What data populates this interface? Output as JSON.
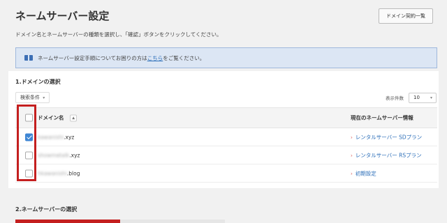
{
  "header": {
    "title": "ネームサーバー設定",
    "domain_list_button": "ドメイン契約一覧",
    "description": "ドメイン名とネームサーバーの種類を選択し、「確認」ボタンをクリックしてください。"
  },
  "info": {
    "text_before": "ネームサーバー設定手順についてお困りの方は",
    "link": "こちら",
    "text_after": "をご覧ください。"
  },
  "section1": {
    "title": "1.ドメインの選択",
    "filter_label": "検索条件",
    "count_label": "表示件数",
    "count_value": "10",
    "columns": {
      "domain": "ドメイン名",
      "nameserver": "現在のネームサーバー情報"
    },
    "rows": [
      {
        "domain_blur": "kawanishi",
        "domain_tld": ".xyz",
        "nameserver": "レンタルサーバー SDプラン",
        "checked": true
      },
      {
        "domain_blur": "showmetalk",
        "domain_tld": ".xyz",
        "nameserver": "レンタルサーバー RSプラン",
        "checked": false
      },
      {
        "domain_blur": "hkawanishi",
        "domain_tld": ".blog",
        "nameserver": "初期設定",
        "checked": false
      }
    ]
  },
  "section2": {
    "title": "2.ネームサーバーの選択"
  },
  "colors": {
    "accent": "#c41f1f",
    "link": "#2a6db8",
    "checkbox_checked": "#3f86d4",
    "info_bg": "#dce6f4"
  }
}
